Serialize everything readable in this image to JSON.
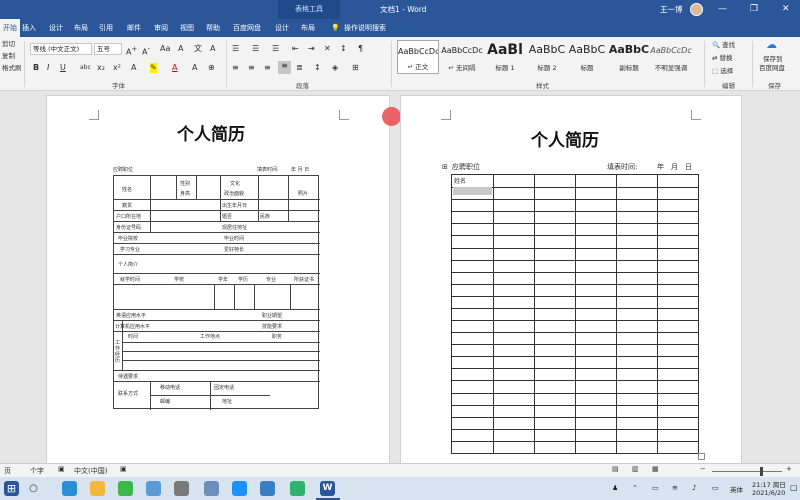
{
  "titlebar": {
    "context_tab": "表格工具",
    "doc_title": "文档1 - Word",
    "user": "王一博",
    "minimize": "—",
    "restore": "❐",
    "close": "✕"
  },
  "tabs": [
    "开始",
    "插入",
    "设计",
    "布局",
    "引用",
    "邮件",
    "审阅",
    "视图",
    "帮助",
    "百度网盘",
    "设计",
    "布局"
  ],
  "tell_me": "操作说明搜索",
  "clipboard": {
    "cut": "剪切",
    "copy": "复制",
    "format_painter": "格式刷"
  },
  "font": {
    "name": "等线 (中文正文)",
    "size": "五号",
    "group_label": "字体"
  },
  "paragraph": {
    "group_label": "段落"
  },
  "styles": {
    "group_label": "样式",
    "items": [
      {
        "sample": "AaBbCcDc",
        "name": "↵ 正文"
      },
      {
        "sample": "AaBbCcDc",
        "name": "↵ 无间隔"
      },
      {
        "sample": "AaBl",
        "name": "标题 1"
      },
      {
        "sample": "AaBbC",
        "name": "标题 2"
      },
      {
        "sample": "AaBbC",
        "name": "标题"
      },
      {
        "sample": "AaBbC",
        "name": "副标题"
      },
      {
        "sample": "AaBbCcDc",
        "name": "不明显强调"
      }
    ]
  },
  "editing": {
    "find": "查找",
    "replace": "替换",
    "select": "选择",
    "group_label": "编辑"
  },
  "save_baidu": {
    "label1": "保存到",
    "label2": "百度网盘",
    "group_label": "保存"
  },
  "page1": {
    "title": "个人简历",
    "labels": {
      "position": "应聘职位",
      "fill_time": "填表时间:",
      "ymd": "年    月    日",
      "name": "姓名",
      "gender": "性别",
      "height": "身高",
      "education": "文化",
      "politics": "政治面貌",
      "photo": "照片",
      "birth": "出生年月日",
      "native": "籍贯",
      "residence": "户口所在地",
      "marital": "婚否",
      "nation": "民族",
      "id": "身份证号码",
      "current_addr": "现居住地址",
      "school": "毕业院校",
      "grad_time": "毕业时间",
      "major": "学习专业",
      "hobby": "爱好特长",
      "intro": "个人简介",
      "study_time": "就学时间",
      "school_col": "学校",
      "year": "学年",
      "degree": "学历",
      "major_col": "专业",
      "cert": "所获证书",
      "english": "英语应用水平",
      "job_expect": "职业期望",
      "computer": "计算机应用水平",
      "salary": "技能要求",
      "time": "时间",
      "work_place": "工作地点",
      "duty": "职务",
      "work_exp": "工作经历",
      "treatment": "待遇要求",
      "contact": "联系方式",
      "mobile": "移动电话",
      "phone": "固定电话",
      "postcode": "邮编",
      "address": "地址"
    }
  },
  "page2": {
    "title": "个人简历",
    "position": "应聘职位",
    "fill_time": "填表时间:",
    "year": "年",
    "month": "月",
    "day": "日",
    "name_cell": "姓名",
    "rows": 23,
    "cols": 6
  },
  "status": {
    "page": "页",
    "words": "个字",
    "lang": "中文(中国)"
  },
  "taskbar": {
    "ime": "英体",
    "time": "21:17 周日",
    "date": "2021/6/20"
  }
}
